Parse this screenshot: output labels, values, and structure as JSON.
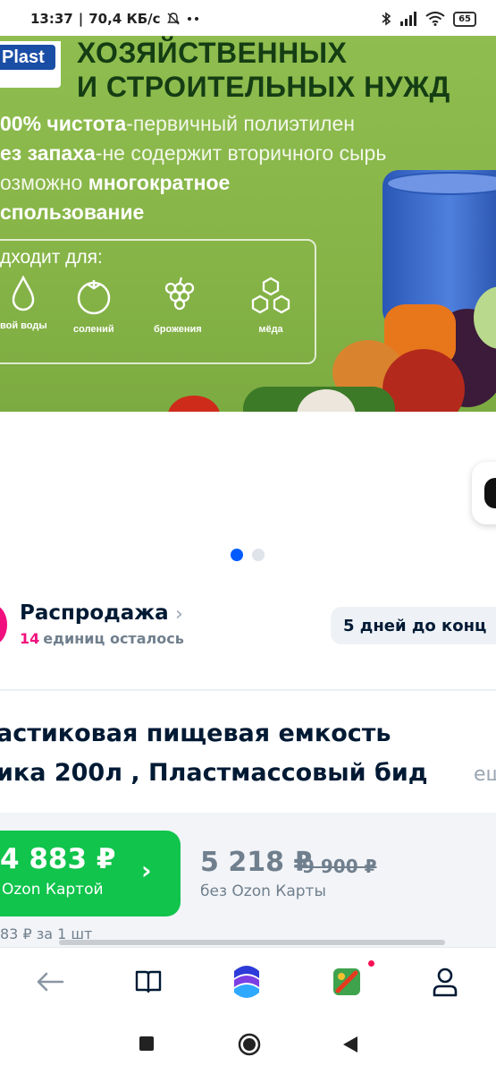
{
  "status_bar": {
    "time": "13:37",
    "speed": "70,4 КБ/с",
    "battery": "65",
    "icons": [
      "mute-bell-icon",
      "more-icon",
      "bluetooth-icon",
      "signal-icon",
      "wifi-icon",
      "battery-icon"
    ]
  },
  "banner": {
    "brand": "Plast",
    "headline_1": "ХОЗЯЙСТВЕННЫХ",
    "headline_2": "И СТРОИТЕЛЬНЫХ НУЖД",
    "bullet_1_bold": "00% чистота",
    "bullet_1_rest": "-первичный полиэтилен",
    "bullet_2_bold": "ез запаха",
    "bullet_2_rest": "-не содержит вторичного сырь",
    "bullet_3_rest": "озможно ",
    "bullet_3_bold": "многократное",
    "bullet_4_bold": "спользование",
    "suitable_title": "дходит для:",
    "uses": [
      "вой воды",
      "солений",
      "брожения",
      "мёда"
    ]
  },
  "carousel": {
    "slides": 2,
    "active": 0
  },
  "sale": {
    "title": "Распродажа",
    "chevron": "›",
    "units_left_number": "14",
    "units_left_text": "единиц осталось",
    "days_left": "5 дней до конц"
  },
  "product": {
    "title_line_1": "астиковая пищевая емкость",
    "title_line_2": "ика 200л , Пластмассовый бид",
    "more_label": "ещ"
  },
  "price": {
    "ozon_card_price": "4 883 ₽",
    "ozon_card_label": "Ozon Картой",
    "chevron": "›",
    "regular_price": "5 218 ₽",
    "old_price": "9 900 ₽",
    "regular_label": "без Ozon Карты",
    "per_unit": "83 ₽ за 1 шт"
  },
  "bottom_nav": {
    "items": [
      "back-icon",
      "catalog-book-icon",
      "ozon-logo-icon",
      "games-icon",
      "profile-icon"
    ]
  },
  "system_nav": {
    "items": [
      "recents-square-icon",
      "home-circle-icon",
      "back-triangle-icon"
    ]
  },
  "colors": {
    "ozon_blue": "#005bff",
    "ozon_green": "#10c44c",
    "sale_pink": "#f1117e",
    "banner_green": "#86b447"
  }
}
